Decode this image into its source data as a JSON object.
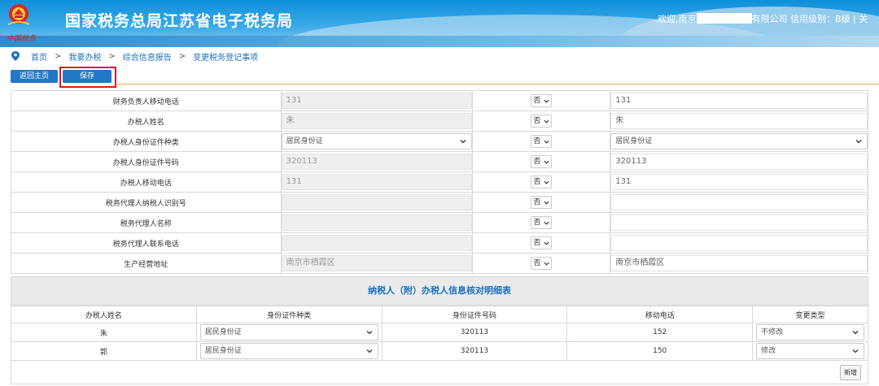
{
  "header": {
    "title": "国家税务总局江苏省电子税务局",
    "slogan": "中国税务",
    "welcome_prefix": "欢迎,南京",
    "welcome_suffix": "有限公司 信用级别：B级 | 关"
  },
  "breadcrumb": [
    "首页",
    "我要办税",
    "综合信息报告",
    "变更税务登记事项"
  ],
  "breadcrumb_sep": ">",
  "toolbar": {
    "home_label": "返回主页",
    "save_label": "保存"
  },
  "rows": [
    {
      "label": "财务负责人移动电话",
      "old": "131",
      "flag": "否",
      "new": "131",
      "type": "input"
    },
    {
      "label": "办税人姓名",
      "old": "朱",
      "flag": "否",
      "new": "朱",
      "type": "input"
    },
    {
      "label": "办税人身份证件种类",
      "old": "居民身份证",
      "flag": "否",
      "new": "居民身份证",
      "type": "select"
    },
    {
      "label": "办税人身份证件号码",
      "old": "320113",
      "flag": "否",
      "new": "320113",
      "type": "input"
    },
    {
      "label": "办税人移动电话",
      "old": "131",
      "flag": "否",
      "new": "131",
      "type": "input"
    },
    {
      "label": "税务代理人纳税人识别号",
      "old": "",
      "flag": "否",
      "new": "",
      "type": "input"
    },
    {
      "label": "税务代理人名称",
      "old": "",
      "flag": "否",
      "new": "",
      "type": "input"
    },
    {
      "label": "税务代理人联系电话",
      "old": "",
      "flag": "否",
      "new": "",
      "type": "input"
    },
    {
      "label": "生产经营地址",
      "old": "南京市栖霞区",
      "flag": "否",
      "new": "南京市栖霞区",
      "type": "input"
    }
  ],
  "section_title": "纳税人（附）办税人信息核对明细表",
  "detail": {
    "headers": [
      "办税人姓名",
      "身份证件种类",
      "身份证件号码",
      "移动电话",
      "变更类型"
    ],
    "rows": [
      {
        "name": "朱",
        "idtype": "居民身份证",
        "idno": "320113",
        "phone": "152",
        "change": "不修改"
      },
      {
        "name": "郭",
        "idtype": "居民身份证",
        "idno": "320113",
        "phone": "150",
        "change": "修改"
      }
    ]
  },
  "add_label": "新增",
  "colors": {
    "primary": "#2277c6",
    "highlight": "#e0171c",
    "link": "#1a6fc0"
  }
}
